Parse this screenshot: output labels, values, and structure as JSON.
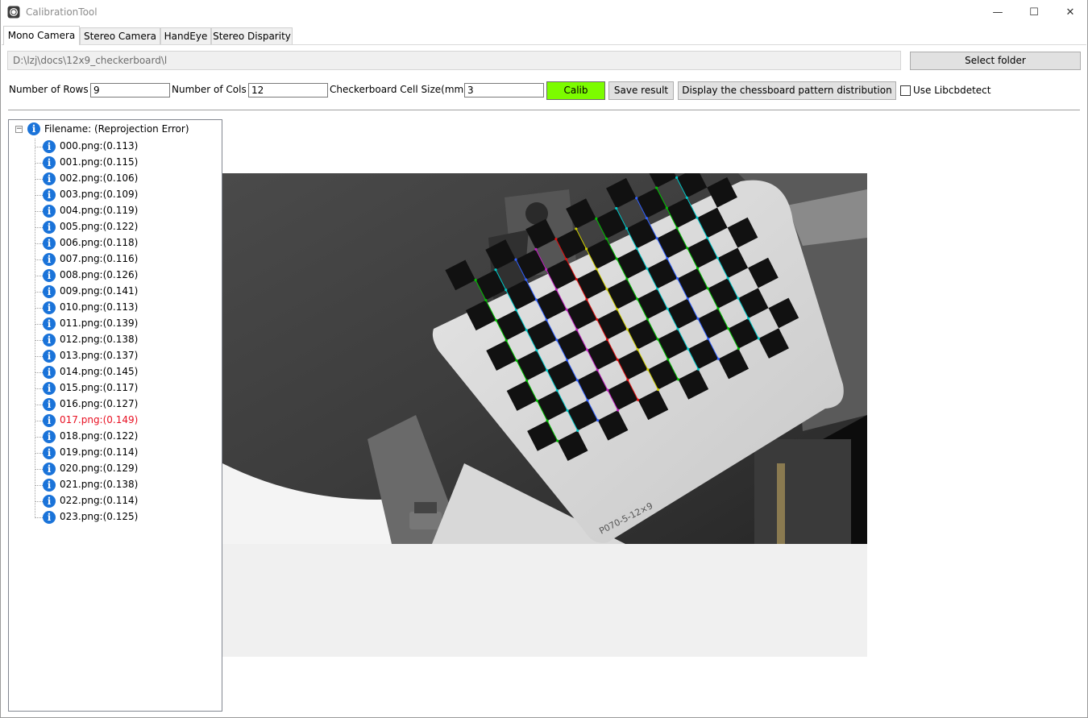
{
  "window": {
    "title": "CalibrationTool",
    "minimize_glyph": "—",
    "maximize_glyph": "☐",
    "close_glyph": "✕"
  },
  "tabs": [
    {
      "label": "Mono Camera",
      "active": true
    },
    {
      "label": "Stereo Camera",
      "active": false
    },
    {
      "label": "HandEye",
      "active": false
    },
    {
      "label": "Stereo Disparity",
      "active": false
    }
  ],
  "folder": {
    "path": "D:\\lzj\\docs\\12x9_checkerboard\\l",
    "select_label": "Select folder"
  },
  "params": {
    "rows_label": "Number of Rows",
    "rows_value": "9",
    "cols_label": "Number of Cols",
    "cols_value": "12",
    "cell_label": "Checkerboard Cell Size(mm)",
    "cell_value": "3",
    "calib_label": "Calib",
    "save_label": "Save result",
    "display_label": "Display the chessboard pattern distribution",
    "libcbdetect_label": "Use Libcbdetect",
    "libcbdetect_checked": false
  },
  "tree": {
    "root_label": "Filename: (Reprojection Error)",
    "expander_glyph": "−",
    "info_glyph": "i",
    "items": [
      {
        "label": "000.png:(0.113)",
        "highlight": false
      },
      {
        "label": "001.png:(0.115)",
        "highlight": false
      },
      {
        "label": "002.png:(0.106)",
        "highlight": false
      },
      {
        "label": "003.png:(0.109)",
        "highlight": false
      },
      {
        "label": "004.png:(0.119)",
        "highlight": false
      },
      {
        "label": "005.png:(0.122)",
        "highlight": false
      },
      {
        "label": "006.png:(0.118)",
        "highlight": false
      },
      {
        "label": "007.png:(0.116)",
        "highlight": false
      },
      {
        "label": "008.png:(0.126)",
        "highlight": false
      },
      {
        "label": "009.png:(0.141)",
        "highlight": false
      },
      {
        "label": "010.png:(0.113)",
        "highlight": false
      },
      {
        "label": "011.png:(0.139)",
        "highlight": false
      },
      {
        "label": "012.png:(0.138)",
        "highlight": false
      },
      {
        "label": "013.png:(0.137)",
        "highlight": false
      },
      {
        "label": "014.png:(0.145)",
        "highlight": false
      },
      {
        "label": "015.png:(0.117)",
        "highlight": false
      },
      {
        "label": "016.png:(0.127)",
        "highlight": false
      },
      {
        "label": "017.png:(0.149)",
        "highlight": true
      },
      {
        "label": "018.png:(0.122)",
        "highlight": false
      },
      {
        "label": "019.png:(0.114)",
        "highlight": false
      },
      {
        "label": "020.png:(0.129)",
        "highlight": false
      },
      {
        "label": "021.png:(0.138)",
        "highlight": false
      },
      {
        "label": "022.png:(0.114)",
        "highlight": false
      },
      {
        "label": "023.png:(0.125)",
        "highlight": false
      }
    ]
  },
  "colors": {
    "calib_button": "#7cfc00",
    "highlight_text": "#e81123",
    "info_icon": "#1a73d9"
  },
  "image": {
    "board_text": "P070-5-12×9"
  }
}
